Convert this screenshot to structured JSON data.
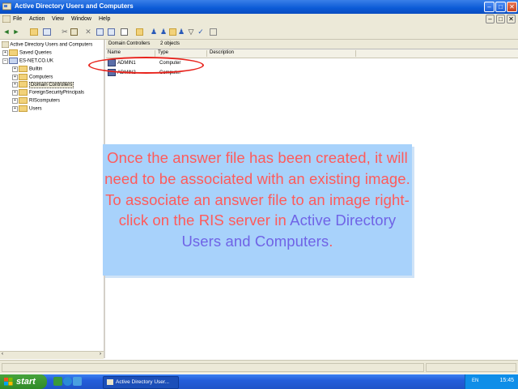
{
  "window": {
    "title": "Active Directory Users and Computers"
  },
  "menu": [
    "File",
    "Action",
    "View",
    "Window",
    "Help"
  ],
  "tree": {
    "root": "Active Directory Users and Computers",
    "items": [
      {
        "label": "Saved Queries",
        "level": 1
      },
      {
        "label": "ES-NET.CO.UK",
        "level": 1
      },
      {
        "label": "Builtin",
        "level": 2
      },
      {
        "label": "Computers",
        "level": 2
      },
      {
        "label": "Domain Controllers",
        "level": 2,
        "selected": true
      },
      {
        "label": "ForeignSecurityPrincipals",
        "level": 2
      },
      {
        "label": "RIScomputers",
        "level": 2
      },
      {
        "label": "Users",
        "level": 2
      }
    ]
  },
  "details": {
    "container": "Domain Controllers",
    "count": "2 objects",
    "columns": [
      "Name",
      "Type",
      "Description"
    ],
    "rows": [
      {
        "name": "ADMIN1",
        "type": "Computer",
        "description": ""
      },
      {
        "name": "ADMIN2",
        "type": "Computer",
        "description": ""
      }
    ]
  },
  "callout": {
    "text": "Once the answer file has been created, it will need to be associated with an existing image. To associate an answer file to an image right-click on the RIS server in",
    "highlight": "Active Directory Users and Computers",
    "end": ".",
    "text_color": "#ff5a5a",
    "highlight_color": "#6f63e6",
    "background": "#a8d2fb"
  },
  "taskbar": {
    "start_label": "start",
    "task": "Active Directory User...",
    "lang": "EN",
    "clock": "15:45"
  },
  "colors": {
    "titlebar": "#0b5ad6",
    "taskbar": "#245edb",
    "start": "#3c9b33",
    "annotation": "#e8231c"
  }
}
